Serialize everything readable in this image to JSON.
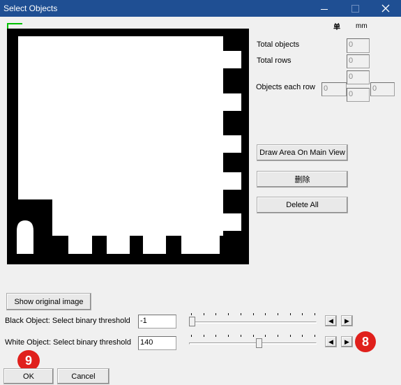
{
  "window": {
    "title": "Select Objects"
  },
  "units": {
    "unit_cn": "单",
    "unit_mm": "mm"
  },
  "fields": {
    "total_objects": {
      "label": "Total objects",
      "value": "0"
    },
    "total_rows": {
      "label": "Total rows",
      "value": "0"
    },
    "objects_each_row": {
      "label": "Objects each row",
      "left": "0",
      "top": "0",
      "bottom": "0",
      "right": "0"
    }
  },
  "buttons": {
    "draw_area": "Draw Area On Main View",
    "delete": "删除",
    "delete_all": "Delete All",
    "show_original": "Show original image",
    "ok": "OK",
    "cancel": "Cancel"
  },
  "thresholds": {
    "black": {
      "label": "Black Object: Select binary threshold",
      "value": "-1",
      "level": 0.0
    },
    "white": {
      "label": "White Object: Select binary threshold",
      "value": "140",
      "level": 0.55
    }
  },
  "badges": {
    "eight": "8",
    "nine": "9"
  },
  "colors": {
    "titlebar": "#1f4f93",
    "badge": "#e0201c",
    "corner": "#00c000"
  }
}
